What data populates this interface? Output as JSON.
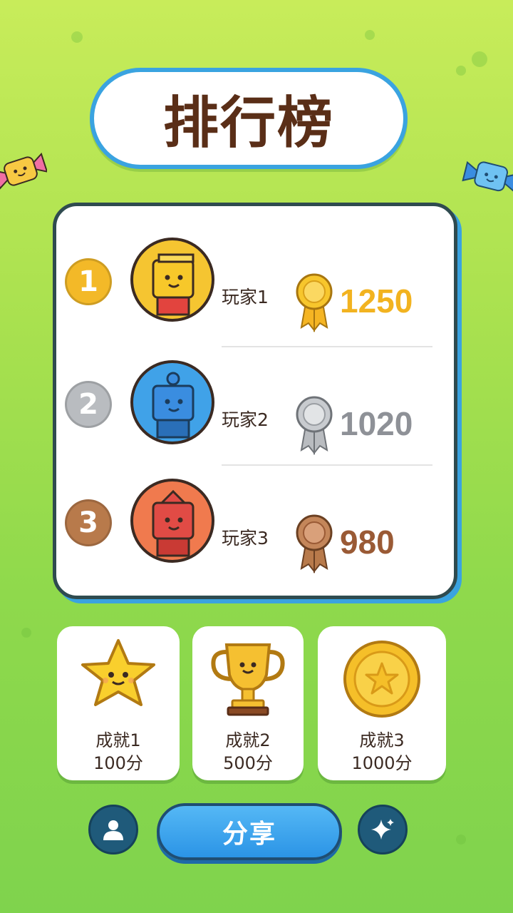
{
  "title": "排行榜",
  "leaderboard": [
    {
      "rank": "1",
      "name": "玩家1",
      "score": "1250",
      "rank_color": "#f3b928",
      "score_color": "#f2b320",
      "avatar_bg": "#f5c531",
      "avatar_color": "#f5c531",
      "medal": "gold-medal-icon"
    },
    {
      "rank": "2",
      "name": "玩家2",
      "score": "1020",
      "rank_color": "#b9bcc0",
      "score_color": "#8e9197",
      "avatar_bg": "#40a2e8",
      "avatar_color": "#3a8de0",
      "medal": "silver-medal-icon"
    },
    {
      "rank": "3",
      "name": "玩家3",
      "score": "980",
      "rank_color": "#b87a4b",
      "score_color": "#9a5a35",
      "avatar_bg": "#f07a4e",
      "avatar_color": "#e14b45",
      "medal": "bronze-medal-icon"
    }
  ],
  "achievements": [
    {
      "name": "成就1",
      "points": "100分",
      "icon": "star-icon"
    },
    {
      "name": "成就2",
      "points": "500分",
      "icon": "trophy-icon"
    },
    {
      "name": "成就3",
      "points": "1000分",
      "icon": "coin-icon"
    }
  ],
  "bottom_bar": {
    "share_label": "分享",
    "left_icon": "profile-icon",
    "right_icon": "sparkle-icon"
  },
  "colors": {
    "accent_blue": "#3aa3e0",
    "title_brown": "#5a2e17"
  }
}
